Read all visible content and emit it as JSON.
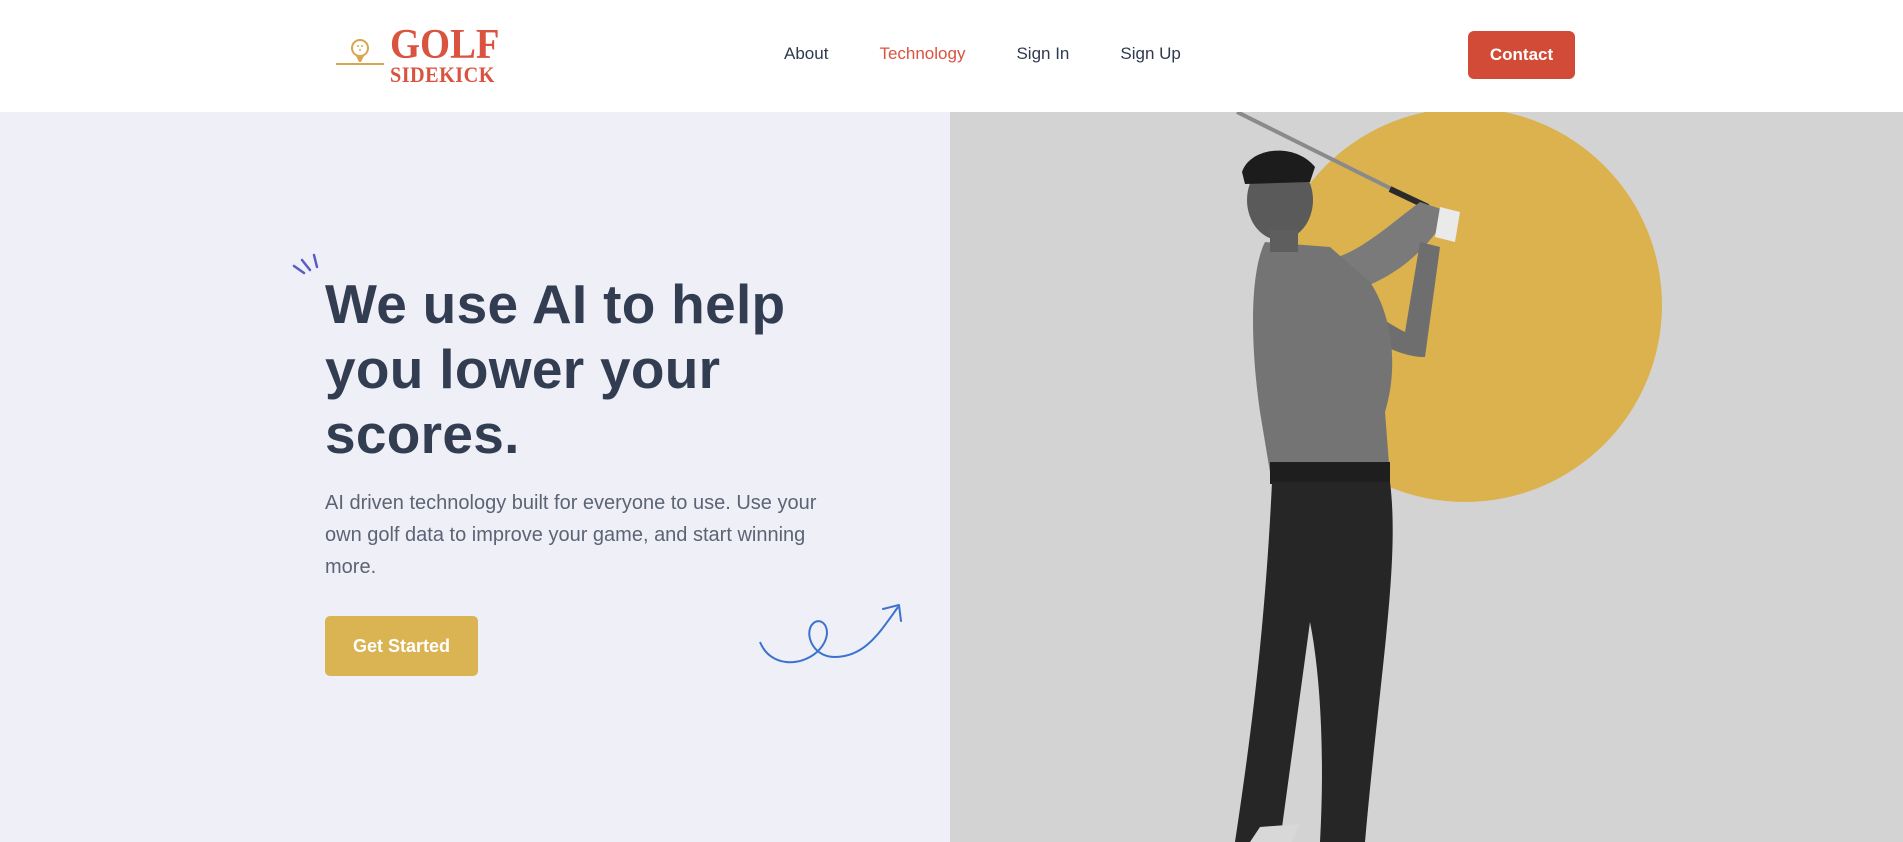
{
  "brand": {
    "logo_line1": "GOLF",
    "logo_line2": "SIDEKICK",
    "color": "#d9533f",
    "icon": "golf-tee-ball-icon"
  },
  "nav": {
    "items": [
      {
        "label": "About",
        "active": false
      },
      {
        "label": "Technology",
        "active": true
      },
      {
        "label": "Sign In",
        "active": false
      },
      {
        "label": "Sign Up",
        "active": false
      }
    ],
    "contact_label": "Contact"
  },
  "hero": {
    "title": "We use AI to help you lower your scores.",
    "subtitle": "AI driven technology built for everyone to use. Use your own golf data to improve your game, and start winning more.",
    "cta_label": "Get Started",
    "image": "golfer-swing-photo"
  },
  "colors": {
    "accent_red": "#d14b36",
    "accent_gold": "#dab353",
    "hero_bg": "#eeeff7",
    "photo_bg": "#d3d3d3",
    "heading": "#333d52",
    "decor_blue": "#3a73cf"
  }
}
